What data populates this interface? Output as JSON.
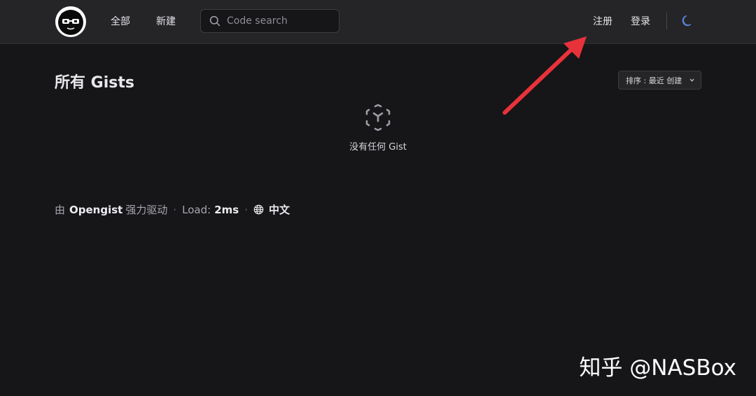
{
  "nav": {
    "all": "全部",
    "new": "新建",
    "search_placeholder": "Code search",
    "register": "注册",
    "login": "登录"
  },
  "main": {
    "title": "所有 Gists",
    "sort_label": "排序 : 最近 创建",
    "empty_text": "没有任何 Gist"
  },
  "footer": {
    "by": "由",
    "brand": "Opengist",
    "powered": "强力驱动",
    "load_label": "Load:",
    "load_value": "2ms",
    "language": "中文"
  },
  "watermark": "知乎 @NASBox",
  "colors": {
    "background": "#161518",
    "navbar": "#252528",
    "annotation_arrow": "#e8323a",
    "theme_icon": "#5b7fd6"
  },
  "icons": {
    "logo": "opengist-logo",
    "search": "search-icon",
    "theme": "moon-icon",
    "empty": "cube-icon",
    "language": "globe-icon",
    "sort": "chevron-down-icon"
  }
}
